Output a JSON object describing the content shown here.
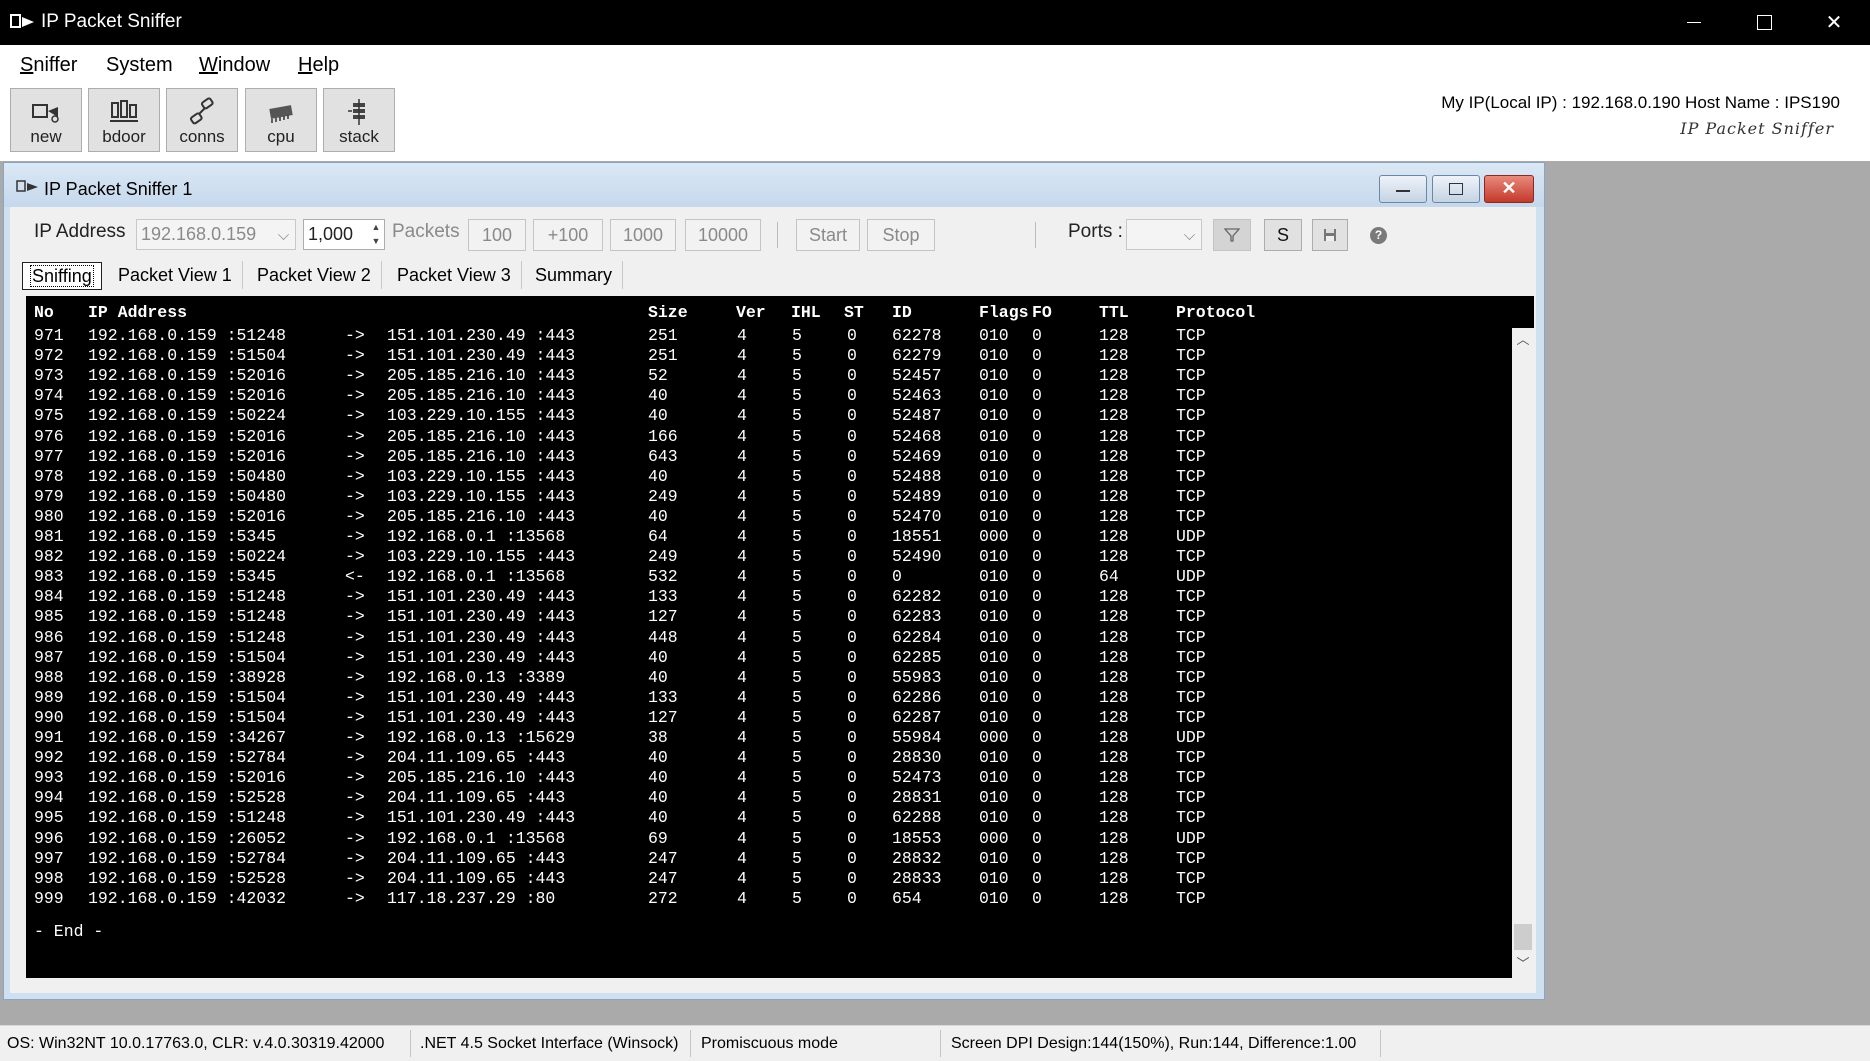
{
  "app": {
    "title": "IP Packet Sniffer"
  },
  "menu": [
    {
      "label": "Sniffer",
      "u": "S",
      "rest": "niffer"
    },
    {
      "label": "System",
      "u": "",
      "rest": "System"
    },
    {
      "label": "Window",
      "u": "W",
      "rest": "indow"
    },
    {
      "label": "Help",
      "u": "H",
      "rest": "elp"
    }
  ],
  "toolbar": {
    "buttons": [
      {
        "label": "new",
        "icon": "new-capture-icon"
      },
      {
        "label": "bdoor",
        "icon": "backdoor-icon"
      },
      {
        "label": "conns",
        "icon": "connections-icon"
      },
      {
        "label": "cpu",
        "icon": "cpu-chip-icon"
      },
      {
        "label": "stack",
        "icon": "stack-icon"
      }
    ],
    "host_info": "My IP(Local IP) : 192.168.0.190  Host Name : IPS190",
    "signature": "IP Packet Sniffer"
  },
  "child": {
    "title": "IP Packet Sniffer 1",
    "ip_label": "IP Address",
    "ip_value": "192.168.0.159",
    "packets_value": "1,000",
    "packets_label": "Packets",
    "qty_buttons": [
      "100",
      "+100",
      "1000",
      "10000"
    ],
    "start_label": "Start",
    "stop_label": "Stop",
    "ports_label": "Ports :",
    "ports_value": "",
    "s_button": "S",
    "tabs": [
      "Sniffing",
      "Packet View 1",
      "Packet View 2",
      "Packet View 3",
      "Summary"
    ],
    "active_tab": 0
  },
  "table": {
    "headers": [
      "No",
      "IP Address",
      "Size",
      "Ver",
      "IHL",
      "ST",
      "ID",
      "Flags",
      "FO",
      "TTL",
      "Protocol"
    ],
    "rows": [
      [
        "971",
        "192.168.0.159 :51248",
        "->",
        "151.101.230.49 :443",
        "251",
        "4",
        "5",
        "0",
        "62278",
        "010",
        "0",
        "128",
        "TCP"
      ],
      [
        "972",
        "192.168.0.159 :51504",
        "->",
        "151.101.230.49 :443",
        "251",
        "4",
        "5",
        "0",
        "62279",
        "010",
        "0",
        "128",
        "TCP"
      ],
      [
        "973",
        "192.168.0.159 :52016",
        "->",
        "205.185.216.10 :443",
        "52",
        "4",
        "5",
        "0",
        "52457",
        "010",
        "0",
        "128",
        "TCP"
      ],
      [
        "974",
        "192.168.0.159 :52016",
        "->",
        "205.185.216.10 :443",
        "40",
        "4",
        "5",
        "0",
        "52463",
        "010",
        "0",
        "128",
        "TCP"
      ],
      [
        "975",
        "192.168.0.159 :50224",
        "->",
        "103.229.10.155 :443",
        "40",
        "4",
        "5",
        "0",
        "52487",
        "010",
        "0",
        "128",
        "TCP"
      ],
      [
        "976",
        "192.168.0.159 :52016",
        "->",
        "205.185.216.10 :443",
        "166",
        "4",
        "5",
        "0",
        "52468",
        "010",
        "0",
        "128",
        "TCP"
      ],
      [
        "977",
        "192.168.0.159 :52016",
        "->",
        "205.185.216.10 :443",
        "643",
        "4",
        "5",
        "0",
        "52469",
        "010",
        "0",
        "128",
        "TCP"
      ],
      [
        "978",
        "192.168.0.159 :50480",
        "->",
        "103.229.10.155 :443",
        "40",
        "4",
        "5",
        "0",
        "52488",
        "010",
        "0",
        "128",
        "TCP"
      ],
      [
        "979",
        "192.168.0.159 :50480",
        "->",
        "103.229.10.155 :443",
        "249",
        "4",
        "5",
        "0",
        "52489",
        "010",
        "0",
        "128",
        "TCP"
      ],
      [
        "980",
        "192.168.0.159 :52016",
        "->",
        "205.185.216.10 :443",
        "40",
        "4",
        "5",
        "0",
        "52470",
        "010",
        "0",
        "128",
        "TCP"
      ],
      [
        "981",
        "192.168.0.159 :5345",
        "->",
        "192.168.0.1 :13568",
        "64",
        "4",
        "5",
        "0",
        "18551",
        "000",
        "0",
        "128",
        "UDP"
      ],
      [
        "982",
        "192.168.0.159 :50224",
        "->",
        "103.229.10.155 :443",
        "249",
        "4",
        "5",
        "0",
        "52490",
        "010",
        "0",
        "128",
        "TCP"
      ],
      [
        "983",
        "192.168.0.159 :5345",
        "<-",
        "192.168.0.1 :13568",
        "532",
        "4",
        "5",
        "0",
        "0",
        "010",
        "0",
        "64",
        "UDP"
      ],
      [
        "984",
        "192.168.0.159 :51248",
        "->",
        "151.101.230.49 :443",
        "133",
        "4",
        "5",
        "0",
        "62282",
        "010",
        "0",
        "128",
        "TCP"
      ],
      [
        "985",
        "192.168.0.159 :51248",
        "->",
        "151.101.230.49 :443",
        "127",
        "4",
        "5",
        "0",
        "62283",
        "010",
        "0",
        "128",
        "TCP"
      ],
      [
        "986",
        "192.168.0.159 :51248",
        "->",
        "151.101.230.49 :443",
        "448",
        "4",
        "5",
        "0",
        "62284",
        "010",
        "0",
        "128",
        "TCP"
      ],
      [
        "987",
        "192.168.0.159 :51504",
        "->",
        "151.101.230.49 :443",
        "40",
        "4",
        "5",
        "0",
        "62285",
        "010",
        "0",
        "128",
        "TCP"
      ],
      [
        "988",
        "192.168.0.159 :38928",
        "->",
        "192.168.0.13 :3389",
        "40",
        "4",
        "5",
        "0",
        "55983",
        "010",
        "0",
        "128",
        "TCP"
      ],
      [
        "989",
        "192.168.0.159 :51504",
        "->",
        "151.101.230.49 :443",
        "133",
        "4",
        "5",
        "0",
        "62286",
        "010",
        "0",
        "128",
        "TCP"
      ],
      [
        "990",
        "192.168.0.159 :51504",
        "->",
        "151.101.230.49 :443",
        "127",
        "4",
        "5",
        "0",
        "62287",
        "010",
        "0",
        "128",
        "TCP"
      ],
      [
        "991",
        "192.168.0.159 :34267",
        "->",
        "192.168.0.13 :15629",
        "38",
        "4",
        "5",
        "0",
        "55984",
        "000",
        "0",
        "128",
        "UDP"
      ],
      [
        "992",
        "192.168.0.159 :52784",
        "->",
        "204.11.109.65 :443",
        "40",
        "4",
        "5",
        "0",
        "28830",
        "010",
        "0",
        "128",
        "TCP"
      ],
      [
        "993",
        "192.168.0.159 :52016",
        "->",
        "205.185.216.10 :443",
        "40",
        "4",
        "5",
        "0",
        "52473",
        "010",
        "0",
        "128",
        "TCP"
      ],
      [
        "994",
        "192.168.0.159 :52528",
        "->",
        "204.11.109.65 :443",
        "40",
        "4",
        "5",
        "0",
        "28831",
        "010",
        "0",
        "128",
        "TCP"
      ],
      [
        "995",
        "192.168.0.159 :51248",
        "->",
        "151.101.230.49 :443",
        "40",
        "4",
        "5",
        "0",
        "62288",
        "010",
        "0",
        "128",
        "TCP"
      ],
      [
        "996",
        "192.168.0.159 :26052",
        "->",
        "192.168.0.1 :13568",
        "69",
        "4",
        "5",
        "0",
        "18553",
        "000",
        "0",
        "128",
        "UDP"
      ],
      [
        "997",
        "192.168.0.159 :52784",
        "->",
        "204.11.109.65 :443",
        "247",
        "4",
        "5",
        "0",
        "28832",
        "010",
        "0",
        "128",
        "TCP"
      ],
      [
        "998",
        "192.168.0.159 :52528",
        "->",
        "204.11.109.65 :443",
        "247",
        "4",
        "5",
        "0",
        "28833",
        "010",
        "0",
        "128",
        "TCP"
      ],
      [
        "999",
        "192.168.0.159 :42032",
        "->",
        "117.18.237.29 :80",
        "272",
        "4",
        "5",
        "0",
        "654",
        "010",
        "0",
        "128",
        "TCP"
      ]
    ],
    "end_text": "- End -"
  },
  "status": [
    "OS: Win32NT 10.0.17763.0,  CLR: v.4.0.30319.42000",
    ".NET 4.5 Socket Interface (Winsock)",
    "Promiscuous mode",
    "Screen DPI Design:144(150%), Run:144, Difference:1.00"
  ]
}
